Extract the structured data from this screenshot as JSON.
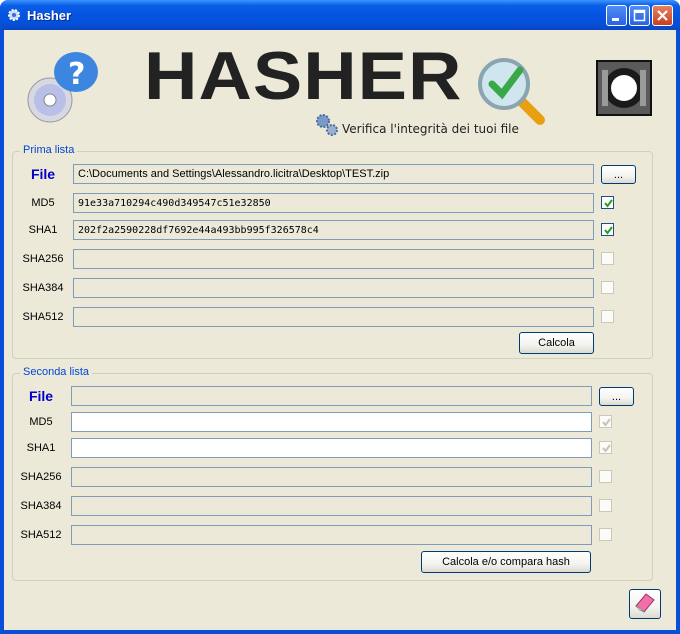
{
  "window": {
    "title": "Hasher"
  },
  "header": {
    "logo_text": "HASHER",
    "tagline": "Verifica l'integrità dei tuoi file"
  },
  "prima": {
    "title": "Prima lista",
    "file_label": "File",
    "file_value": "C:\\Documents and Settings\\Alessandro.licitra\\Desktop\\TEST.zip",
    "browse_label": "...",
    "rows": [
      {
        "label": "MD5",
        "value": "91e33a710294c490d349547c51e32850",
        "checked": true
      },
      {
        "label": "SHA1",
        "value": "202f2a2590228df7692e44a493bb995f326578c4",
        "checked": true
      },
      {
        "label": "SHA256",
        "value": "",
        "checked": false
      },
      {
        "label": "SHA384",
        "value": "",
        "checked": false
      },
      {
        "label": "SHA512",
        "value": "",
        "checked": false
      }
    ],
    "calc_label": "Calcola"
  },
  "seconda": {
    "title": "Seconda lista",
    "file_label": "File",
    "file_value": "",
    "browse_label": "...",
    "rows": [
      {
        "label": "MD5",
        "value": "",
        "checked": true
      },
      {
        "label": "SHA1",
        "value": "",
        "checked": true
      },
      {
        "label": "SHA256",
        "value": "",
        "checked": false
      },
      {
        "label": "SHA384",
        "value": "",
        "checked": false
      },
      {
        "label": "SHA512",
        "value": "",
        "checked": false
      }
    ],
    "calc_label": "Calcola e/o compara hash"
  }
}
